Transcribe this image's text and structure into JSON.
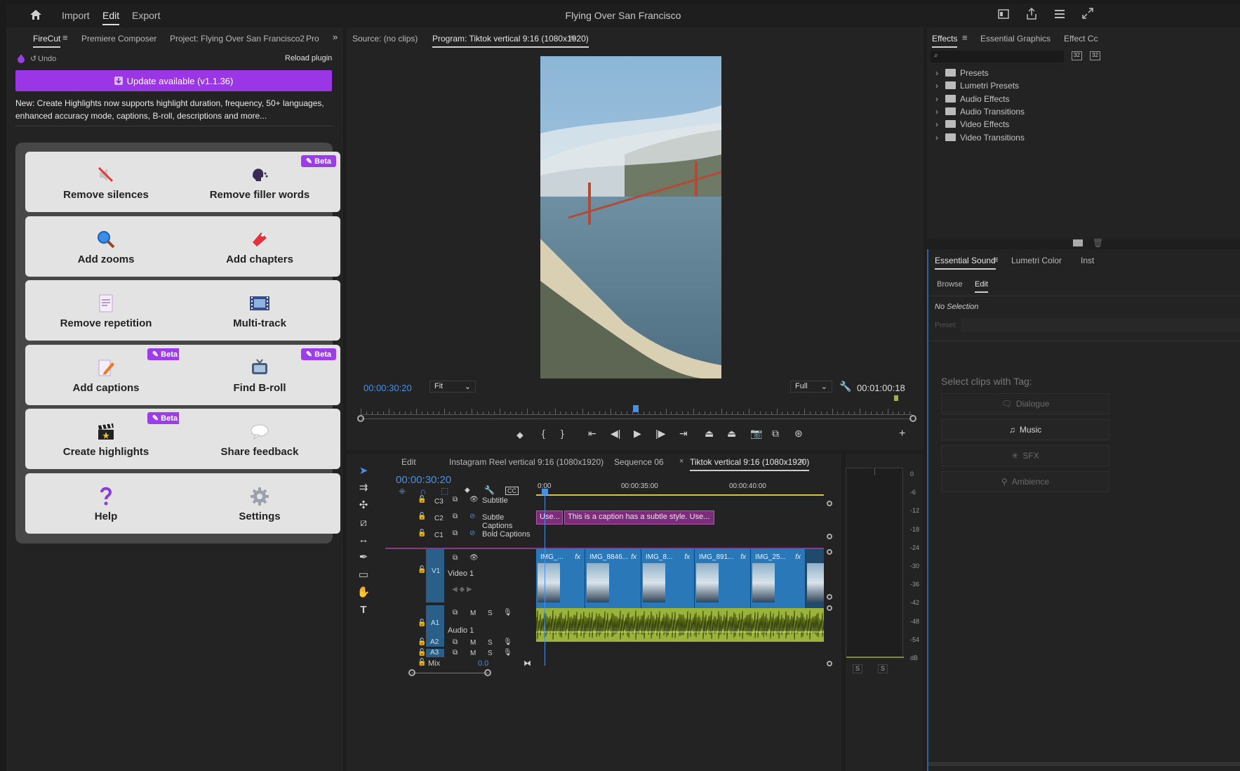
{
  "app": {
    "title": "Flying Over San Francisco",
    "menu": {
      "import": "Import",
      "edit": "Edit",
      "export": "Export"
    }
  },
  "left_panel": {
    "tabs": [
      "FireCut",
      "Premiere Composer",
      "Project: Flying Over San Francisco2",
      "Pro"
    ],
    "undo": "Undo",
    "reload": "Reload plugin",
    "update_banner": "Update available (v1.1.36)",
    "news": "New: Create Highlights now supports highlight duration, frequency, 50+ languages, enhanced accuracy mode, captions, B-roll, descriptions and more...",
    "beta_label": "Beta",
    "buttons": [
      {
        "label": "Remove silences",
        "icon": "muted-speaker-icon",
        "beta": false
      },
      {
        "label": "Remove filler words",
        "icon": "speaking-head-icon",
        "beta": true
      },
      {
        "label": "Add zooms",
        "icon": "magnifier-icon",
        "beta": false
      },
      {
        "label": "Add chapters",
        "icon": "bookmark-pin-icon",
        "beta": false
      },
      {
        "label": "Remove repetition",
        "icon": "document-icon",
        "beta": false
      },
      {
        "label": "Multi-track",
        "icon": "film-icon",
        "beta": false
      },
      {
        "label": "Add captions",
        "icon": "edit-document-icon",
        "beta": true
      },
      {
        "label": "Find B-roll",
        "icon": "tv-icon",
        "beta": true
      },
      {
        "label": "Create highlights",
        "icon": "clapper-icon",
        "beta": true
      },
      {
        "label": "Share feedback",
        "icon": "speech-bubble-icon",
        "beta": false
      },
      {
        "label": "Help",
        "icon": "question-icon",
        "beta": false
      },
      {
        "label": "Settings",
        "icon": "gear-icon",
        "beta": false
      }
    ]
  },
  "monitor": {
    "source_tab": "Source: (no clips)",
    "program_tab": "Program: Tiktok vertical 9:16 (1080x1920)",
    "current_time": "00:00:30:20",
    "fit": "Fit",
    "quality": "Full",
    "duration": "00:01:00:18"
  },
  "effects_panel": {
    "tabs": [
      "Effects",
      "Essential Graphics",
      "Effect Cc"
    ],
    "items": [
      "Presets",
      "Lumetri Presets",
      "Audio Effects",
      "Audio Transitions",
      "Video Effects",
      "Video Transitions"
    ]
  },
  "essential_sound": {
    "tabs": [
      "Essential Sound",
      "Lumetri Color",
      "Inst"
    ],
    "subtabs": [
      "Browse",
      "Edit"
    ],
    "no_selection": "No Selection",
    "preset_label": "Preset:",
    "select_heading": "Select clips with Tag:",
    "tags": [
      "Dialogue",
      "Music",
      "SFX",
      "Ambience"
    ]
  },
  "timeline": {
    "tabs": [
      "Edit",
      "Instagram Reel vertical 9:16 (1080x1920)",
      "Sequence 06",
      "Tiktok vertical 9:16 (1080x1920)"
    ],
    "timecode": "00:00:30:20",
    "ruler": [
      "0:00",
      "00:00:35:00",
      "00:00:40:00"
    ],
    "tracks": {
      "c3": "C3",
      "c2": "C2",
      "c1": "C1",
      "v1": "V1",
      "a1": "A1",
      "a2": "A2",
      "a3": "A3",
      "subtitle": "Subtitle",
      "subtle_captions": "Subtle Captions",
      "bold_captions": "Bold Captions",
      "video1": "Video 1",
      "audio1": "Audio 1",
      "mix": "Mix",
      "mix_value": "0.0",
      "m": "M",
      "s": "S"
    },
    "caption_short": "Use...",
    "caption_text": "This is a caption has a subtle style. Use...",
    "clips": [
      "IMG_...",
      "IMG_8846...",
      "IMG_8...",
      "IMG_891...",
      "IMG_25..."
    ],
    "fx": "fx"
  },
  "meter": {
    "scale": [
      "0",
      "-6",
      "-12",
      "-18",
      "-24",
      "-30",
      "-36",
      "-42",
      "-48",
      "-54",
      "dB"
    ],
    "solo": [
      "S",
      "S"
    ]
  },
  "colors": {
    "accent_purple": "#9b3ee8",
    "playhead_blue": "#4a8fe0",
    "audio_green": "#b6d24a",
    "video_clip_blue": "#2b78b9",
    "caption_purple": "#7a2d78"
  }
}
